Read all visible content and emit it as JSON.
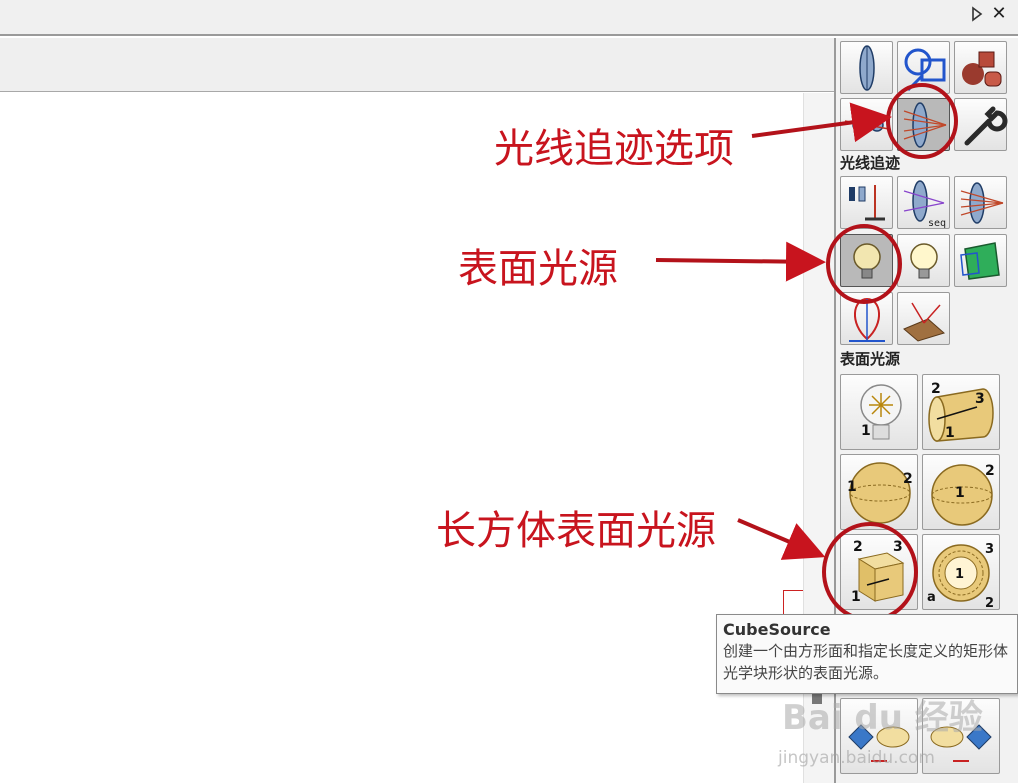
{
  "palette": {
    "section_raytrace": "光线追迹",
    "section_surface_source": "表面光源"
  },
  "annotations": {
    "raytrace_options": "光线追迹选项",
    "surface_source": "表面光源",
    "cube_surface_source": "长方体表面光源"
  },
  "tooltip": {
    "title": "CubeSource",
    "body": "创建一个由方形面和指定长度定义的矩形体光学块形状的表面光源。"
  },
  "watermark": {
    "text": "Bai du 经验",
    "sub": "jingyan.baidu.com"
  },
  "colors": {
    "annotation_red": "#c8141e",
    "selected_button": "#b9b9b9",
    "source_gold": "#e8c97a"
  },
  "window": {
    "close_label": "✕"
  }
}
